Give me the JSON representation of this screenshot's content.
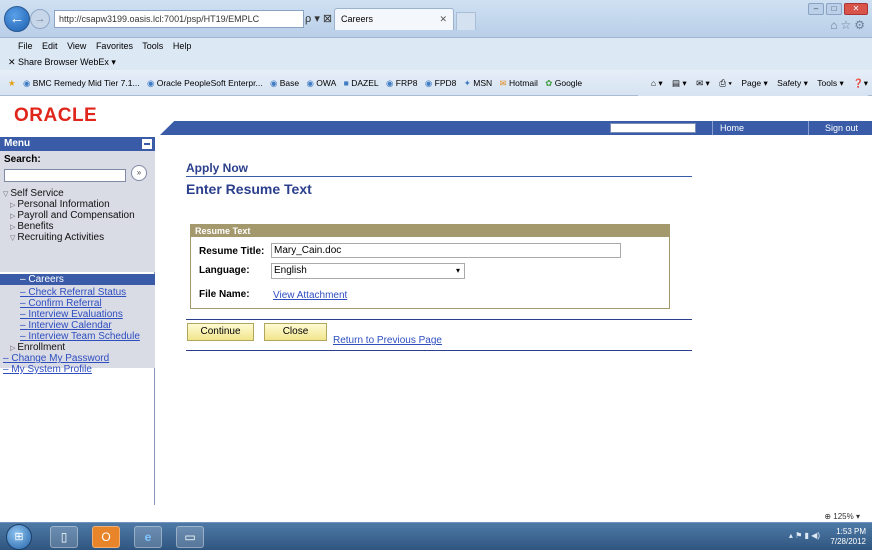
{
  "browser": {
    "address": "http://csapw3199.oasis.lcl:7001/psp/HT19/EMPLC",
    "address_icons": "ρ ▾ ⊠ ↻ ✕",
    "tab_title": "Careers",
    "menu": [
      "File",
      "Edit",
      "View",
      "Favorites",
      "Tools",
      "Help"
    ],
    "share_bar": "✕   Share Browser   WebEx ▾",
    "favorites": [
      "BMC Remedy Mid Tier 7.1...",
      "Oracle PeopleSoft Enterpr...",
      "Base",
      "OWA",
      "DAZEL",
      "FRP8",
      "FPD8",
      "MSN",
      "Hotmail",
      "Google"
    ],
    "commands": [
      "Page ▾",
      "Safety ▾",
      "Tools ▾"
    ]
  },
  "header": {
    "logo": "ORACLE",
    "home": "Home",
    "sign_out": "Sign out"
  },
  "menu": {
    "title": "Menu",
    "search_label": "Search:",
    "search_go": "»",
    "items": [
      {
        "label": "Self Service"
      },
      {
        "label": "Personal Information"
      },
      {
        "label": "Payroll and Compensation"
      },
      {
        "label": "Benefits"
      },
      {
        "label": "Recruiting Activities"
      },
      {
        "label": "Careers"
      },
      {
        "label": "Check Referral Status"
      },
      {
        "label": "Confirm Referral"
      },
      {
        "label": "Interview Evaluations"
      },
      {
        "label": "Interview Calendar"
      },
      {
        "label": "Interview Team Schedule"
      },
      {
        "label": "Enrollment"
      },
      {
        "label": "Change My Password"
      },
      {
        "label": "My System Profile"
      }
    ]
  },
  "content": {
    "breadcrumb": "Apply Now",
    "title": "Enter Resume Text",
    "box_title": "Resume Text",
    "resume_title_label": "Resume Title:",
    "resume_title_value": "Mary_Cain.doc",
    "language_label": "Language:",
    "language_value": "English",
    "file_name_label": "File Name:",
    "view_attachment": "View Attachment",
    "continue": "Continue",
    "close": "Close",
    "return": "Return to Previous Page"
  },
  "status": {
    "zoom": "125%"
  },
  "taskbar": {
    "time": "1:53 PM",
    "date": "7/28/2012"
  }
}
